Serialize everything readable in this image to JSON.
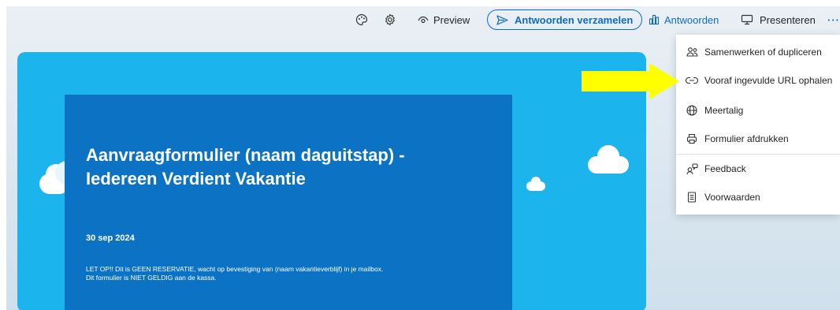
{
  "toolbar": {
    "preview_label": "Preview",
    "collect_label": "Antwoorden verzamelen",
    "responses_label": "Antwoorden",
    "present_label": "Presenteren",
    "more_label": "···"
  },
  "form": {
    "title": "Aanvraagformulier (naam daguitstap) - Iedereen Verdient Vakantie",
    "date": "30 sep 2024",
    "note_line1": "LET OP!!  Dit is GEEN RESERVATIE, wacht op bevestiging van (naam vakantieverblijf) in je mailbox.",
    "note_line2": "Dit formulier is NIET GELDIG aan de kassa."
  },
  "menu": {
    "items": [
      {
        "label": "Samenwerken of dupliceren",
        "icon": "people-icon"
      },
      {
        "label": "Vooraf ingevulde URL ophalen",
        "icon": "link-icon"
      },
      {
        "label": "Meertalig",
        "icon": "globe-icon"
      },
      {
        "label": "Formulier afdrukken",
        "icon": "printer-icon"
      },
      {
        "label": "Feedback",
        "icon": "feedback-icon"
      },
      {
        "label": "Voorwaarden",
        "icon": "document-icon"
      }
    ]
  },
  "colors": {
    "accent": "#0f6cbd",
    "header_bg": "#1cb4ec",
    "inner_card": "#0c72c3",
    "arrow": "#ffff00"
  }
}
